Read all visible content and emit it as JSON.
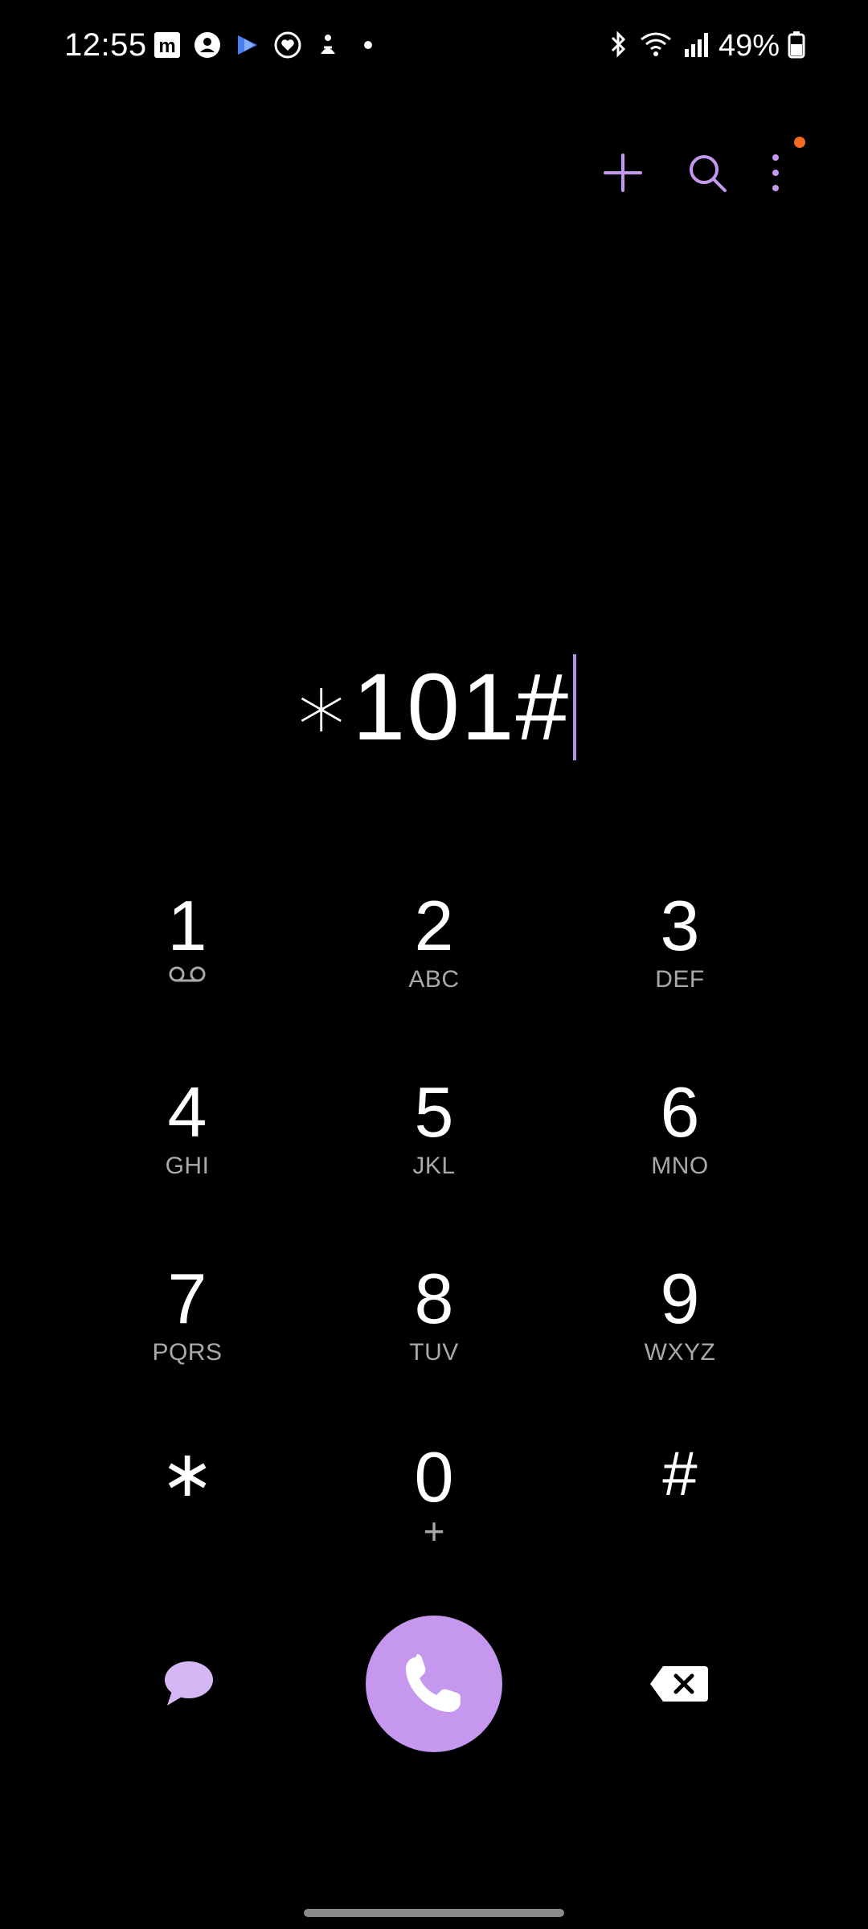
{
  "status_bar": {
    "time": "12:55",
    "battery": "49%",
    "notification_icons": [
      "m-app-icon",
      "account-icon",
      "copilot-icon",
      "heart-care-icon",
      "lotus-icon",
      "more-notifications-dot"
    ],
    "status_icons": [
      "bluetooth-icon",
      "wifi-icon",
      "signal-icon",
      "battery-icon"
    ]
  },
  "actions": {
    "add": "add-contact-icon",
    "search": "search-icon",
    "more": "more-options-icon",
    "accent_color": "#c597ee",
    "badge_color": "#f26a21"
  },
  "dialer": {
    "number": "∗101#"
  },
  "keypad": [
    {
      "digit": "1",
      "letters": "",
      "voicemail": true
    },
    {
      "digit": "2",
      "letters": "ABC"
    },
    {
      "digit": "3",
      "letters": "DEF"
    },
    {
      "digit": "4",
      "letters": "GHI"
    },
    {
      "digit": "5",
      "letters": "JKL"
    },
    {
      "digit": "6",
      "letters": "MNO"
    },
    {
      "digit": "7",
      "letters": "PQRS"
    },
    {
      "digit": "8",
      "letters": "TUV"
    },
    {
      "digit": "9",
      "letters": "WXYZ"
    },
    {
      "digit": "∗",
      "letters": ""
    },
    {
      "digit": "0",
      "letters": "+"
    },
    {
      "digit": "#",
      "letters": ""
    }
  ],
  "bottom": {
    "message": "message-icon",
    "call": "phone-icon",
    "backspace": "backspace-icon",
    "call_color": "#c597ee"
  }
}
